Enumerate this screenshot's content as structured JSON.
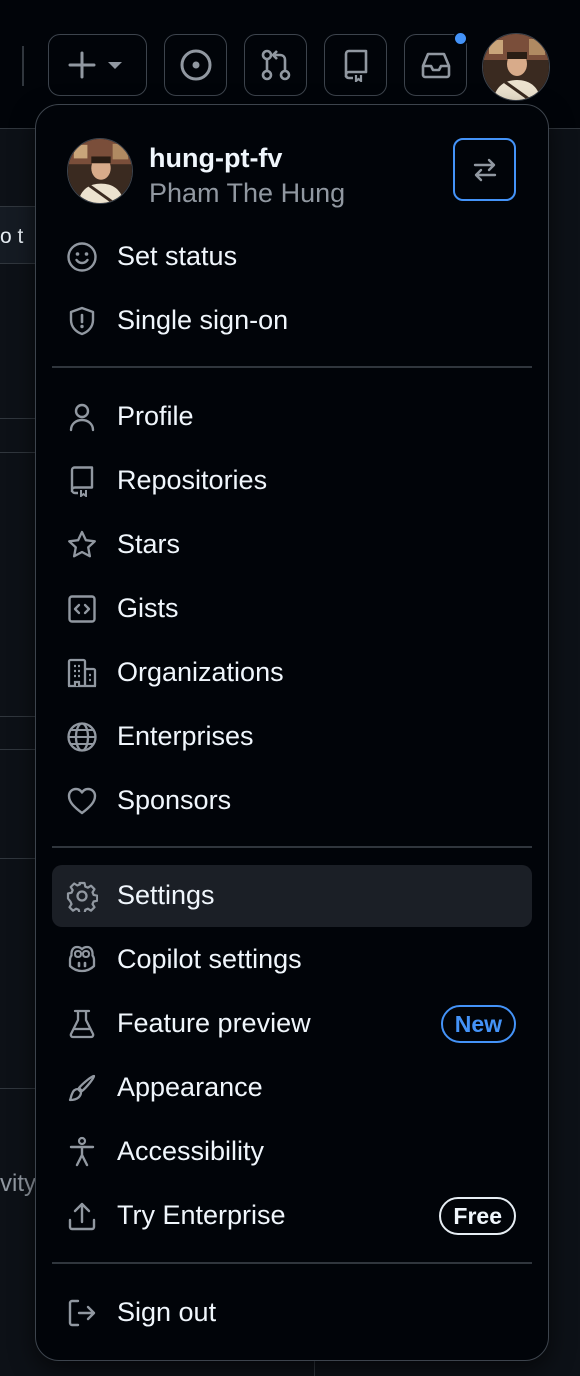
{
  "header": {
    "create_icon": "plus-icon",
    "issues_icon": "issue-opened-icon",
    "pulls_icon": "git-pull-request-icon",
    "repo_icon": "repo-icon",
    "inbox_icon": "inbox-icon",
    "notification_color": "#4493f8"
  },
  "background": {
    "chip_text": "o t",
    "side_text": "vity"
  },
  "menu": {
    "login": "hung-pt-fv",
    "full_name": "Pham The Hung",
    "switch_icon": "arrow-switch-icon",
    "section1": [
      {
        "label": "Set status",
        "icon": "smiley-icon"
      },
      {
        "label": "Single sign-on",
        "icon": "shield-lock-icon"
      }
    ],
    "section2": [
      {
        "label": "Profile",
        "icon": "person-icon"
      },
      {
        "label": "Repositories",
        "icon": "repo-icon"
      },
      {
        "label": "Stars",
        "icon": "star-icon"
      },
      {
        "label": "Gists",
        "icon": "code-square-icon"
      },
      {
        "label": "Organizations",
        "icon": "organization-icon"
      },
      {
        "label": "Enterprises",
        "icon": "globe-icon"
      },
      {
        "label": "Sponsors",
        "icon": "heart-icon"
      }
    ],
    "section3": [
      {
        "label": "Settings",
        "icon": "gear-icon",
        "active": true
      },
      {
        "label": "Copilot settings",
        "icon": "copilot-icon"
      },
      {
        "label": "Feature preview",
        "icon": "beaker-icon",
        "badge": "New"
      },
      {
        "label": "Appearance",
        "icon": "paintbrush-icon"
      },
      {
        "label": "Accessibility",
        "icon": "accessibility-icon"
      },
      {
        "label": "Try Enterprise",
        "icon": "upload-icon",
        "badge": "Free"
      }
    ],
    "section4": [
      {
        "label": "Sign out",
        "icon": "sign-out-icon"
      }
    ],
    "accent_color": "#4493f8"
  }
}
